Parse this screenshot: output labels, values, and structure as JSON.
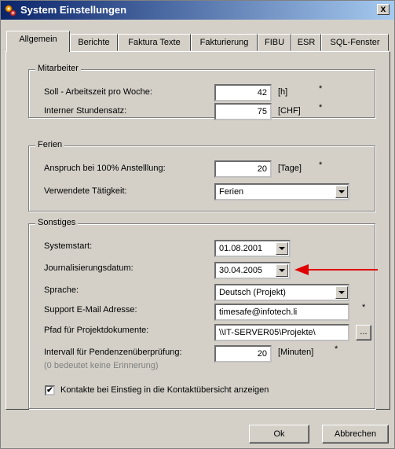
{
  "window": {
    "title": "System Einstellungen",
    "close": "x"
  },
  "tabs": [
    "Allgemein",
    "Berichte",
    "Faktura Texte",
    "Fakturierung",
    "FIBU",
    "ESR",
    "SQL-Fenster"
  ],
  "mitarbeiter": {
    "legend": "Mitarbeiter",
    "soll_label": "Soll - Arbeitszeit pro Woche:",
    "soll_value": "42",
    "soll_unit": "[h]",
    "stundensatz_label": "Interner Stundensatz:",
    "stundensatz_value": "75",
    "stundensatz_unit": "[CHF]"
  },
  "ferien": {
    "legend": "Ferien",
    "anspruch_label": "Anspruch bei 100% Anstelllung:",
    "anspruch_value": "20",
    "anspruch_unit": "[Tage]",
    "taetigkeit_label": "Verwendete Tätigkeit:",
    "taetigkeit_value": "Ferien"
  },
  "sonstiges": {
    "legend": "Sonstiges",
    "systemstart_label": "Systemstart:",
    "systemstart_value": "01.08.2001",
    "journal_label": "Journalisierungsdatum:",
    "journal_value": "30.04.2005",
    "sprache_label": "Sprache:",
    "sprache_value": "Deutsch (Projekt)",
    "email_label": "Support E-Mail Adresse:",
    "email_value": "timesafe@infotech.li",
    "pfad_label": "Pfad für Projektdokumente:",
    "pfad_value": "\\\\IT-SERVER05\\Projekte\\",
    "browse": "...",
    "intervall_label": "Intervall für Pendenzenüberprüfung:",
    "intervall_hint": "(0 bedeutet keine Erinnerung)",
    "intervall_value": "20",
    "intervall_unit": "[Minuten]",
    "kontakte_label": "Kontakte bei Einstieg in die Kontaktübersicht anzeigen",
    "kontakte_checked": true
  },
  "required_mark": "*",
  "buttons": {
    "ok": "Ok",
    "cancel": "Abbrechen"
  },
  "colors": {
    "title_gradient_start": "#0a246a",
    "title_gradient_end": "#a6caf0",
    "face": "#d4d0c8",
    "arrow": "#e00000"
  }
}
